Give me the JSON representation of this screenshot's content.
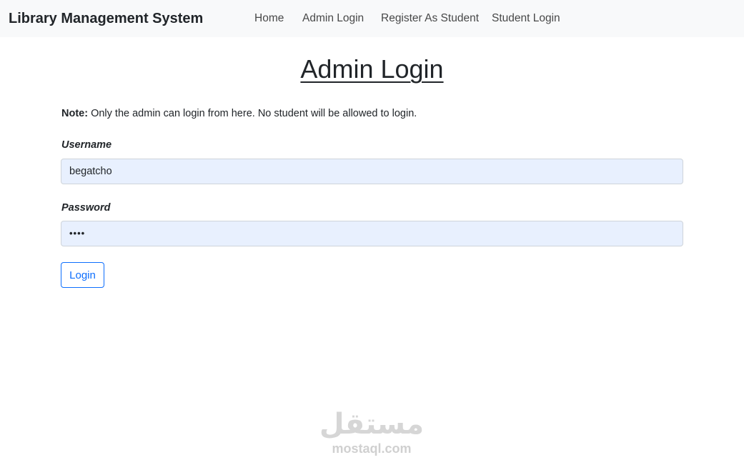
{
  "navbar": {
    "brand": "Library Management System",
    "links": [
      "Home",
      "Admin Login",
      "Register As Student",
      "Student Login"
    ]
  },
  "main": {
    "title": "Admin Login",
    "note_prefix": "Note:",
    "note_text": " Only the admin can login from here. No student will be allowed to login.",
    "username_label": "Username",
    "username_value": "begatcho",
    "password_label": "Password",
    "password_value": "••••",
    "login_button": "Login"
  },
  "watermark": {
    "arabic": "مستقل",
    "latin": "mostaql.com"
  },
  "colors": {
    "navbar_bg": "#f8f9fa",
    "input_bg": "#e8f0fe",
    "button_accent": "#0d6efd"
  }
}
